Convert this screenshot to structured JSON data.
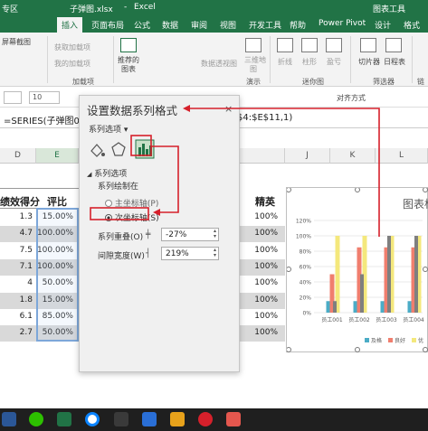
{
  "titlebar": {
    "left_text": "专区",
    "filename": "子弹图.xlsx",
    "separator": "-",
    "app": "Excel",
    "context": "图表工具"
  },
  "tabs": [
    "插入",
    "页面布局",
    "公式",
    "数据",
    "审阅",
    "视图",
    "开发工具",
    "帮助",
    "Power Pivot",
    "设计",
    "格式"
  ],
  "ribbon": {
    "screenshot": "屏幕截图",
    "get_addins": "获取加载项",
    "my_addins": "我的加载项",
    "addins_group": "加载项",
    "recommended_charts_line1": "推荐的",
    "recommended_charts_line2": "图表",
    "maps_line1": "数据透视图",
    "three_d_line1": "三维地",
    "three_d_line2": "图",
    "demo_group": "演示",
    "line": "折线",
    "column": "柱形",
    "winloss": "盈亏",
    "sparklines_group": "迷你图",
    "slicer": "切片器",
    "timeline": "日程表",
    "filters_group": "筛选器",
    "link_group": "链"
  },
  "fontrow": {
    "font_size": "10",
    "alignment_label": "对齐方式"
  },
  "formula": {
    "text": "=SERIES(子弹图01",
    "text_tail": "$4:$E$11,1)"
  },
  "grid": {
    "col_d": "D",
    "col_e": "E",
    "col_j": "J",
    "col_k": "K",
    "col_l": "L",
    "header_d": "绩效得分",
    "header_e": "评比",
    "header_right": "精英",
    "scores": [
      "1.3",
      "4.7",
      "7.5",
      "7.1",
      "4",
      "1.8",
      "6.1",
      "2.7"
    ],
    "ratios": [
      "15.00%",
      "100.00%",
      "100.00%",
      "100.00%",
      "50.00%",
      "15.00%",
      "85.00%",
      "50.00%"
    ],
    "elite": [
      "100%",
      "100%",
      "100%",
      "100%",
      "100%",
      "100%",
      "100%",
      "100%"
    ]
  },
  "panel": {
    "title": "设置数据系列格式",
    "options_dropdown": "系列选项",
    "section": "系列选项",
    "plot_on": "系列绘制在",
    "primary_axis": "主坐标轴(P)",
    "secondary_axis": "次坐标轴(S)",
    "overlap_label": "系列重叠(O)",
    "overlap_value": "-27%",
    "gap_label": "间隙宽度(W)",
    "gap_value": "219%"
  },
  "chart_data": {
    "type": "bar",
    "title": "图表标",
    "categories": [
      "员工001",
      "员工002",
      "员工003",
      "员工004"
    ],
    "yticks": [
      "120%",
      "100%",
      "80%",
      "60%",
      "40%",
      "20%",
      "0%"
    ],
    "ylim": [
      0,
      120
    ],
    "series": [
      {
        "name": "及格",
        "color": "#4bacc6",
        "values": [
          15,
          15,
          15,
          15
        ]
      },
      {
        "name": "良好",
        "color": "#f07e6e",
        "values": [
          50,
          85,
          85,
          85
        ]
      },
      {
        "name": "优",
        "color": "#f4e87c",
        "values": [
          100,
          100,
          100,
          100
        ]
      },
      {
        "color": "#7f7f7f",
        "values": [
          15,
          50,
          100,
          100
        ]
      }
    ],
    "legend_labels": [
      "及格",
      "良好",
      "优"
    ]
  },
  "colors": {
    "excel_green": "#217346",
    "annotation_red": "#d6202b"
  }
}
